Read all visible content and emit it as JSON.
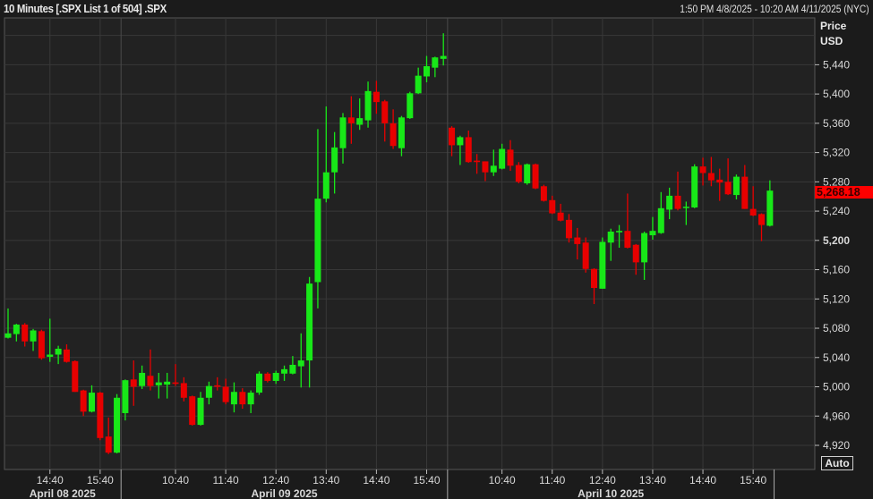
{
  "header": {
    "title": "10 Minutes [.SPX List 1 of 504] .SPX",
    "range": "1:50 PM 4/8/2025 - 10:20 AM 4/11/2025 (NYC)"
  },
  "axis": {
    "price_label": "Price",
    "currency_label": "USD",
    "auto_button": "Auto"
  },
  "last_price": "5,268.18",
  "colors": {
    "up": "#18e818",
    "down": "#e80000",
    "grid": "#383838",
    "background": "#222222"
  },
  "chart_data": {
    "type": "candlestick",
    "title": "10 Minutes [.SPX List 1 of 504] .SPX",
    "ylabel": "Price USD",
    "ylim": [
      4887,
      5504
    ],
    "yticks": [
      5480,
      5440,
      5400,
      5360,
      5320,
      5280,
      5240,
      5200,
      5160,
      5120,
      5080,
      5040,
      5000,
      4960,
      4920
    ],
    "ytick_labels": [
      "5,440",
      "5,400",
      "5,360",
      "5,320",
      "5,280",
      "5,240",
      "5,200",
      "5,160",
      "5,120",
      "5,080",
      "5,040",
      "5,000",
      "4,960",
      "4,920"
    ],
    "grid": true,
    "xticks": [
      {
        "label": "14:40",
        "index": 5
      },
      {
        "label": "15:40",
        "index": 11
      },
      {
        "label": "10:40",
        "index": 20
      },
      {
        "label": "11:40",
        "index": 26
      },
      {
        "label": "12:40",
        "index": 32
      },
      {
        "label": "13:40",
        "index": 38
      },
      {
        "label": "14:40",
        "index": 44
      },
      {
        "label": "15:40",
        "index": 50
      },
      {
        "label": "10:40",
        "index": 59
      },
      {
        "label": "11:40",
        "index": 65
      },
      {
        "label": "12:40",
        "index": 71
      },
      {
        "label": "13:40",
        "index": 77
      },
      {
        "label": "14:40",
        "index": 83
      },
      {
        "label": "15:40",
        "index": 89
      }
    ],
    "days": [
      {
        "label": "April 08 2025",
        "start": 0,
        "end": 13
      },
      {
        "label": "April 09 2025",
        "start": 14,
        "end": 52
      },
      {
        "label": "April 10 2025",
        "start": 53,
        "end": 91
      }
    ],
    "ohlc": [
      [
        5067,
        5107,
        5066,
        5073
      ],
      [
        5072,
        5086,
        5062,
        5085
      ],
      [
        5085,
        5087,
        5055,
        5062
      ],
      [
        5062,
        5079,
        5049,
        5077
      ],
      [
        5076,
        5078,
        5037,
        5039
      ],
      [
        5041,
        5093,
        5034,
        5044
      ],
      [
        5044,
        5056,
        5031,
        5052
      ],
      [
        5051,
        5058,
        5033,
        5034
      ],
      [
        5035,
        5036,
        4993,
        4993
      ],
      [
        4995,
        4996,
        4960,
        4966
      ],
      [
        4966,
        5002,
        4965,
        4992
      ],
      [
        4992,
        4993,
        4927,
        4930
      ],
      [
        4932,
        4958,
        4908,
        4910
      ],
      [
        4910,
        4990,
        4909,
        4985
      ],
      [
        4964,
        5010,
        4954,
        5009
      ],
      [
        5010,
        5036,
        4974,
        5000
      ],
      [
        5001,
        5029,
        4997,
        5019
      ],
      [
        5015,
        5051,
        4995,
        5001
      ],
      [
        5002,
        5019,
        4984,
        5006
      ],
      [
        5003,
        5019,
        4984,
        5007
      ],
      [
        5006,
        5031,
        5001,
        5004
      ],
      [
        5005,
        5013,
        4980,
        4985
      ],
      [
        4987,
        4988,
        4947,
        4948
      ],
      [
        4948,
        4993,
        4947,
        4985
      ],
      [
        4985,
        5007,
        4976,
        5001
      ],
      [
        5002,
        5013,
        4995,
        5000
      ],
      [
        5000,
        5011,
        4976,
        4979
      ],
      [
        4976,
        5006,
        4965,
        4993
      ],
      [
        4993,
        4998,
        4970,
        4976
      ],
      [
        4976,
        4995,
        4964,
        4992
      ],
      [
        4992,
        5021,
        4989,
        5018
      ],
      [
        5018,
        5020,
        5006,
        5008
      ],
      [
        5008,
        5022,
        5004,
        5019
      ],
      [
        5018,
        5029,
        5008,
        5024
      ],
      [
        5018,
        5042,
        5017,
        5030
      ],
      [
        5028,
        5073,
        4999,
        5036
      ],
      [
        5036,
        5150,
        4999,
        5141
      ],
      [
        5143,
        5352,
        5107,
        5257
      ],
      [
        5257,
        5383,
        5252,
        5293
      ],
      [
        5293,
        5348,
        5264,
        5327
      ],
      [
        5326,
        5374,
        5305,
        5368
      ],
      [
        5368,
        5397,
        5332,
        5360
      ],
      [
        5358,
        5394,
        5351,
        5367
      ],
      [
        5364,
        5417,
        5354,
        5404
      ],
      [
        5403,
        5418,
        5373,
        5389
      ],
      [
        5390,
        5392,
        5335,
        5360
      ],
      [
        5360,
        5379,
        5325,
        5329
      ],
      [
        5326,
        5370,
        5315,
        5368
      ],
      [
        5367,
        5403,
        5366,
        5401
      ],
      [
        5401,
        5436,
        5400,
        5425
      ],
      [
        5424,
        5452,
        5416,
        5438
      ],
      [
        5436,
        5451,
        5423,
        5450
      ],
      [
        5448,
        5483,
        5439,
        5452
      ],
      [
        5354,
        5356,
        5315,
        5330
      ],
      [
        5330,
        5343,
        5303,
        5341
      ],
      [
        5341,
        5350,
        5306,
        5307
      ],
      [
        5309,
        5318,
        5291,
        5307
      ],
      [
        5308,
        5308,
        5281,
        5293
      ],
      [
        5293,
        5324,
        5288,
        5302
      ],
      [
        5298,
        5332,
        5297,
        5325
      ],
      [
        5324,
        5337,
        5295,
        5302
      ],
      [
        5303,
        5307,
        5278,
        5280
      ],
      [
        5278,
        5305,
        5276,
        5304
      ],
      [
        5304,
        5305,
        5270,
        5271
      ],
      [
        5274,
        5276,
        5253,
        5254
      ],
      [
        5255,
        5261,
        5236,
        5237
      ],
      [
        5238,
        5250,
        5226,
        5227
      ],
      [
        5228,
        5236,
        5197,
        5203
      ],
      [
        5204,
        5217,
        5174,
        5195
      ],
      [
        5197,
        5204,
        5156,
        5161
      ],
      [
        5161,
        5162,
        5113,
        5135
      ],
      [
        5134,
        5204,
        5134,
        5198
      ],
      [
        5197,
        5216,
        5172,
        5212
      ],
      [
        5211,
        5221,
        5190,
        5213
      ],
      [
        5213,
        5264,
        5189,
        5190
      ],
      [
        5194,
        5195,
        5153,
        5170
      ],
      [
        5170,
        5212,
        5146,
        5210
      ],
      [
        5207,
        5232,
        5201,
        5213
      ],
      [
        5210,
        5266,
        5209,
        5244
      ],
      [
        5242,
        5272,
        5229,
        5261
      ],
      [
        5261,
        5294,
        5241,
        5243
      ],
      [
        5245,
        5253,
        5221,
        5246
      ],
      [
        5245,
        5304,
        5244,
        5301
      ],
      [
        5301,
        5313,
        5275,
        5292
      ],
      [
        5292,
        5314,
        5274,
        5282
      ],
      [
        5283,
        5298,
        5254,
        5279
      ],
      [
        5280,
        5312,
        5262,
        5263
      ],
      [
        5262,
        5290,
        5256,
        5287
      ],
      [
        5287,
        5303,
        5243,
        5243
      ],
      [
        5243,
        5274,
        5233,
        5234
      ],
      [
        5236,
        5237,
        5199,
        5221
      ],
      [
        5220,
        5282,
        5219,
        5268
      ]
    ]
  }
}
